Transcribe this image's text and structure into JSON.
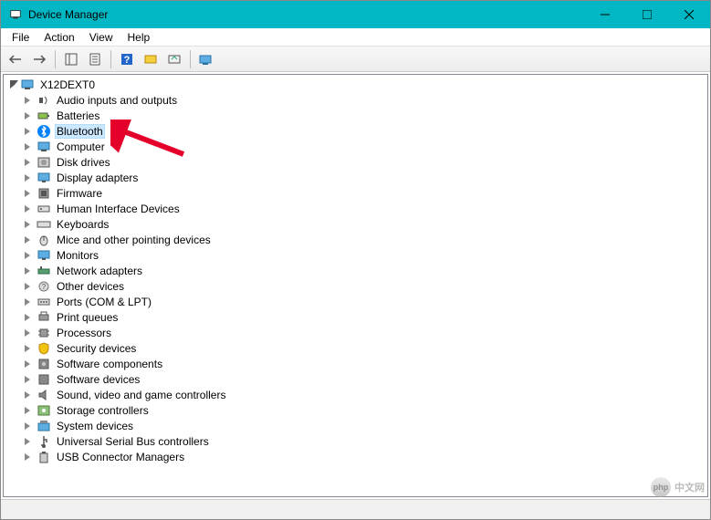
{
  "window": {
    "title": "Device Manager"
  },
  "menu": {
    "file": "File",
    "action": "Action",
    "view": "View",
    "help": "Help"
  },
  "tree": {
    "root": "X12DEXT0",
    "selected_index": 2,
    "nodes": [
      {
        "label": "Audio inputs and outputs",
        "icon": "audio"
      },
      {
        "label": "Batteries",
        "icon": "battery"
      },
      {
        "label": "Bluetooth",
        "icon": "bluetooth"
      },
      {
        "label": "Computer",
        "icon": "computer"
      },
      {
        "label": "Disk drives",
        "icon": "disk"
      },
      {
        "label": "Display adapters",
        "icon": "display"
      },
      {
        "label": "Firmware",
        "icon": "firmware"
      },
      {
        "label": "Human Interface Devices",
        "icon": "hid"
      },
      {
        "label": "Keyboards",
        "icon": "keyboard"
      },
      {
        "label": "Mice and other pointing devices",
        "icon": "mouse"
      },
      {
        "label": "Monitors",
        "icon": "monitor"
      },
      {
        "label": "Network adapters",
        "icon": "network"
      },
      {
        "label": "Other devices",
        "icon": "other"
      },
      {
        "label": "Ports (COM & LPT)",
        "icon": "ports"
      },
      {
        "label": "Print queues",
        "icon": "print"
      },
      {
        "label": "Processors",
        "icon": "cpu"
      },
      {
        "label": "Security devices",
        "icon": "security"
      },
      {
        "label": "Software components",
        "icon": "sw-comp"
      },
      {
        "label": "Software devices",
        "icon": "sw-dev"
      },
      {
        "label": "Sound, video and game controllers",
        "icon": "sound"
      },
      {
        "label": "Storage controllers",
        "icon": "storage"
      },
      {
        "label": "System devices",
        "icon": "system"
      },
      {
        "label": "Universal Serial Bus controllers",
        "icon": "usb"
      },
      {
        "label": "USB Connector Managers",
        "icon": "usb-conn"
      }
    ]
  },
  "watermark": {
    "text": "中文网",
    "logo": "php"
  }
}
